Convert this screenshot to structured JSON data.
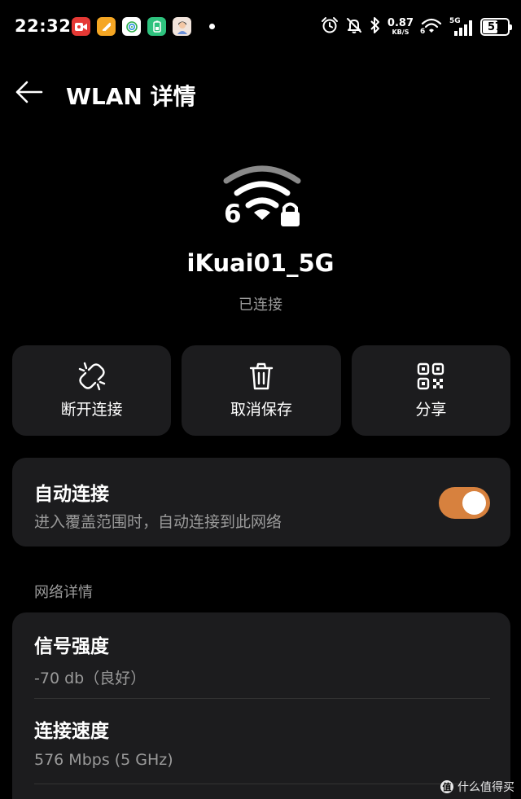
{
  "status_bar": {
    "time": "22:32",
    "net_speed_value": "0.87",
    "net_speed_unit": "KB/S",
    "network_type": "5G",
    "battery": "57",
    "app_icons": [
      "video-recorder-app-icon",
      "orange-app-icon",
      "fingerprint-app-icon",
      "battery-app-icon",
      "avatar-app-icon"
    ],
    "status_icons": [
      "alarm-icon",
      "mute-icon",
      "bluetooth-icon",
      "wifi6-icon",
      "cell-signal-icon"
    ]
  },
  "header": {
    "back_icon": "arrow-left-icon",
    "title": "WLAN 详情"
  },
  "network": {
    "icon": "wifi6-lock-icon",
    "wifi_generation": "6",
    "ssid": "iKuai01_5G",
    "status": "已连接"
  },
  "actions": [
    {
      "icon": "unlink-icon",
      "label": "断开连接"
    },
    {
      "icon": "trash-icon",
      "label": "取消保存"
    },
    {
      "icon": "qr-code-icon",
      "label": "分享"
    }
  ],
  "auto_connect": {
    "title": "自动连接",
    "description": "进入覆盖范围时，自动连接到此网络",
    "enabled": true
  },
  "details_section_label": "网络详情",
  "details": [
    {
      "label": "信号强度",
      "value": "-70 db（良好）"
    },
    {
      "label": "连接速度",
      "value": "576 Mbps (5 GHz)"
    }
  ],
  "watermark": {
    "mark": "值",
    "text": "什么值得买"
  },
  "colors": {
    "background": "#000000",
    "card": "#1c1c1e",
    "accent": "#d7813e",
    "secondary_text": "#9a9a9a"
  }
}
